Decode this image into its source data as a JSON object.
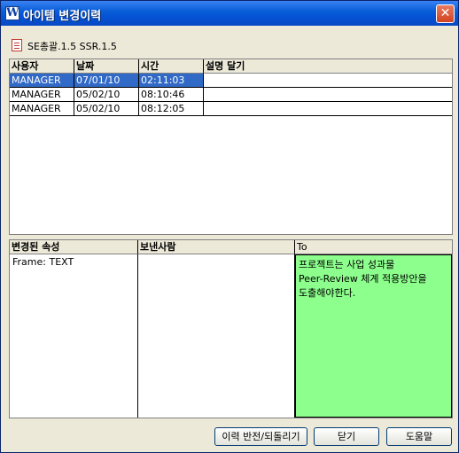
{
  "window": {
    "title": "아이템 변경이력",
    "app_icon_letter": "W",
    "close_glyph": "✕"
  },
  "subheader": {
    "icon": "document-icon",
    "text": "SE총괄.1.5  SSR.1.5"
  },
  "history_table": {
    "columns": [
      "사용자",
      "날짜",
      "시간",
      "설명 달기"
    ],
    "rows": [
      {
        "user": "MANAGER",
        "date": "07/01/10",
        "time": "02:11:03",
        "desc": "",
        "selected": true
      },
      {
        "user": "MANAGER",
        "date": "05/02/10",
        "time": "08:10:46",
        "desc": "",
        "selected": false
      },
      {
        "user": "MANAGER",
        "date": "05/02/10",
        "time": "08:12:05",
        "desc": "",
        "selected": false
      }
    ],
    "selected_color": "#3169c6"
  },
  "detail_table": {
    "columns": [
      "변경된 속성",
      "보낸사람",
      "To"
    ],
    "property": "Frame: TEXT",
    "sender": "",
    "to_lines": [
      "프로젝트는 사업 성과물",
      "Peer-Review 체계 적용방안을",
      "도출해야한다."
    ],
    "to_background": "#8cff8c"
  },
  "buttons": {
    "revert": "이력 반전/되돌리기",
    "close": "닫기",
    "help": "도움말"
  }
}
